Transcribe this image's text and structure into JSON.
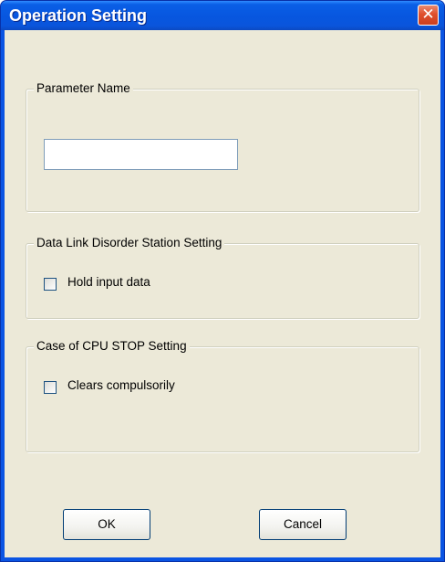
{
  "window": {
    "title": "Operation Setting",
    "close_glyph": "✕"
  },
  "groups": {
    "parameter_name": {
      "legend": "Parameter Name",
      "input_value": ""
    },
    "data_link": {
      "legend": "Data Link Disorder Station Setting",
      "checkbox_label": "Hold input data",
      "checked": false
    },
    "cpu_stop": {
      "legend": "Case of CPU STOP Setting",
      "checkbox_label": "Clears compulsorily",
      "checked": false
    }
  },
  "buttons": {
    "ok": "OK",
    "cancel": "Cancel"
  }
}
